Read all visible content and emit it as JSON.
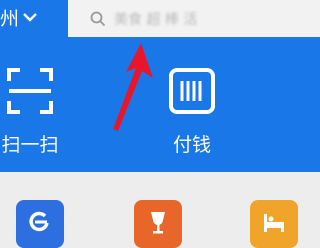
{
  "header": {
    "city_label": "州",
    "search_placeholder": "美食 超 棒 活"
  },
  "quick_actions": [
    {
      "label": "扫一扫",
      "icon": "scan-icon"
    },
    {
      "label": "付钱",
      "icon": "pay-code-icon"
    }
  ],
  "service_tiles": [
    {
      "icon": "e-service-icon",
      "color": "#2d6fe0"
    },
    {
      "icon": "wine-glass-icon",
      "color": "#e8662a"
    },
    {
      "icon": "bed-icon",
      "color": "#f0a52a"
    }
  ],
  "annotation": {
    "icon": "red-arrow-icon",
    "color": "#e8162a"
  },
  "colors": {
    "header_blue": "#1a77e8",
    "panel_gray": "#ededed"
  }
}
